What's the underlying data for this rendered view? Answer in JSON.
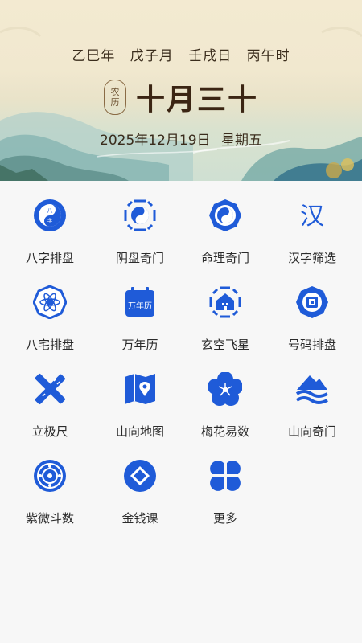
{
  "header": {
    "ganzhi": [
      "乙巳年",
      "戊子月",
      "壬戌日",
      "丙午时"
    ],
    "lunar_badge": "农\n历",
    "lunar_date": "十月三十",
    "solar_date": "2025年12月19日",
    "weekday": "星期五"
  },
  "icons": {
    "bazi_text": "八\n字",
    "hanzi_text": "汉",
    "wannian_text": "万年历"
  },
  "menu": [
    {
      "label": "八字排盘",
      "icon": "bazi-icon"
    },
    {
      "label": "阴盘奇门",
      "icon": "yinpan-bagua-icon"
    },
    {
      "label": "命理奇门",
      "icon": "mingli-taiji-icon"
    },
    {
      "label": "汉字筛选",
      "icon": "hanzi-icon"
    },
    {
      "label": "八宅排盘",
      "icon": "bazhai-icon"
    },
    {
      "label": "万年历",
      "icon": "calendar-icon"
    },
    {
      "label": "玄空飞星",
      "icon": "xuankong-house-icon"
    },
    {
      "label": "号码排盘",
      "icon": "number-bagua-icon"
    },
    {
      "label": "立极尺",
      "icon": "ruler-icon"
    },
    {
      "label": "山向地图",
      "icon": "map-pin-icon"
    },
    {
      "label": "梅花易数",
      "icon": "plum-blossom-icon"
    },
    {
      "label": "山向奇门",
      "icon": "mountain-wave-icon"
    },
    {
      "label": "紫微斗数",
      "icon": "ziwei-disc-icon"
    },
    {
      "label": "金钱课",
      "icon": "coin-icon"
    },
    {
      "label": "更多",
      "icon": "more-grid-icon"
    }
  ],
  "colors": {
    "accent": "#1f5bd8",
    "header_text": "#3a2c1c"
  }
}
